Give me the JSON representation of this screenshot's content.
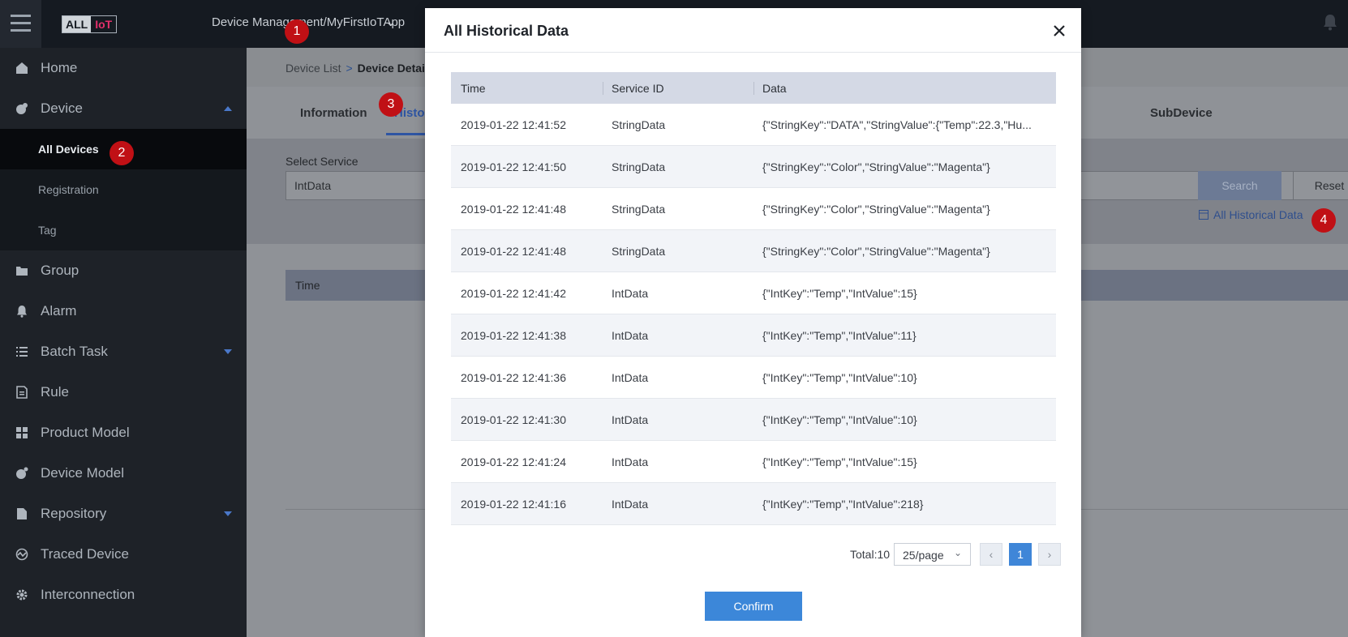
{
  "header": {
    "logo_left": "ALL",
    "logo_right": "IoT",
    "app_switch": "Device Management/MyFirstIoTApp"
  },
  "sidebar": {
    "items": [
      {
        "label": "Home",
        "icon": "home-icon"
      },
      {
        "label": "Device",
        "icon": "device-icon",
        "expanded": true
      },
      {
        "label": "Group",
        "icon": "folder-icon"
      },
      {
        "label": "Alarm",
        "icon": "bell-icon"
      },
      {
        "label": "Batch Task",
        "icon": "list-icon"
      },
      {
        "label": "Rule",
        "icon": "rule-icon"
      },
      {
        "label": "Product Model",
        "icon": "grid-icon"
      },
      {
        "label": "Device Model",
        "icon": "device-model-icon"
      },
      {
        "label": "Repository",
        "icon": "file-icon"
      },
      {
        "label": "Traced Device",
        "icon": "trace-icon"
      },
      {
        "label": "Interconnection",
        "icon": "gear-icon"
      }
    ],
    "device_sub": [
      {
        "label": "All Devices",
        "active": true
      },
      {
        "label": "Registration"
      },
      {
        "label": "Tag"
      }
    ]
  },
  "breadcrumb": {
    "parent": "Device List",
    "separator": ">",
    "current": "Device Details"
  },
  "tabs": [
    {
      "label": "Information"
    },
    {
      "label": "Historical Data",
      "active": true
    },
    {
      "label": "SubDevice"
    }
  ],
  "filter": {
    "service_label": "Select Service",
    "service_value": "IntData",
    "search_button": "Search",
    "reset_button": "Reset",
    "all_history_link": "All Historical Data"
  },
  "background_table": {
    "col_time": "Time"
  },
  "modal": {
    "title": "All Historical Data",
    "columns": [
      "Time",
      "Service ID",
      "Data"
    ],
    "rows": [
      {
        "time": "2019-01-22 12:41:52",
        "service": "StringData",
        "data": "{\"StringKey\":\"DATA\",\"StringValue\":{\"Temp\":22.3,\"Hu..."
      },
      {
        "time": "2019-01-22 12:41:50",
        "service": "StringData",
        "data": "{\"StringKey\":\"Color\",\"StringValue\":\"Magenta\"}"
      },
      {
        "time": "2019-01-22 12:41:48",
        "service": "StringData",
        "data": "{\"StringKey\":\"Color\",\"StringValue\":\"Magenta\"}"
      },
      {
        "time": "2019-01-22 12:41:48",
        "service": "StringData",
        "data": "{\"StringKey\":\"Color\",\"StringValue\":\"Magenta\"}"
      },
      {
        "time": "2019-01-22 12:41:42",
        "service": "IntData",
        "data": "{\"IntKey\":\"Temp\",\"IntValue\":15}"
      },
      {
        "time": "2019-01-22 12:41:38",
        "service": "IntData",
        "data": "{\"IntKey\":\"Temp\",\"IntValue\":11}"
      },
      {
        "time": "2019-01-22 12:41:36",
        "service": "IntData",
        "data": "{\"IntKey\":\"Temp\",\"IntValue\":10}"
      },
      {
        "time": "2019-01-22 12:41:30",
        "service": "IntData",
        "data": "{\"IntKey\":\"Temp\",\"IntValue\":10}"
      },
      {
        "time": "2019-01-22 12:41:24",
        "service": "IntData",
        "data": "{\"IntKey\":\"Temp\",\"IntValue\":15}"
      },
      {
        "time": "2019-01-22 12:41:16",
        "service": "IntData",
        "data": "{\"IntKey\":\"Temp\",\"IntValue\":218}"
      }
    ],
    "pagination": {
      "total": "Total:10",
      "page_size": "25/page",
      "current_page": "1"
    },
    "confirm_button": "Confirm"
  },
  "markers": [
    "1",
    "2",
    "3",
    "4"
  ],
  "colors": {
    "accent": "#3c87d9",
    "marker": "#c01015",
    "sidebar_bg": "#1e2228",
    "topbar_bg": "#151a21"
  }
}
